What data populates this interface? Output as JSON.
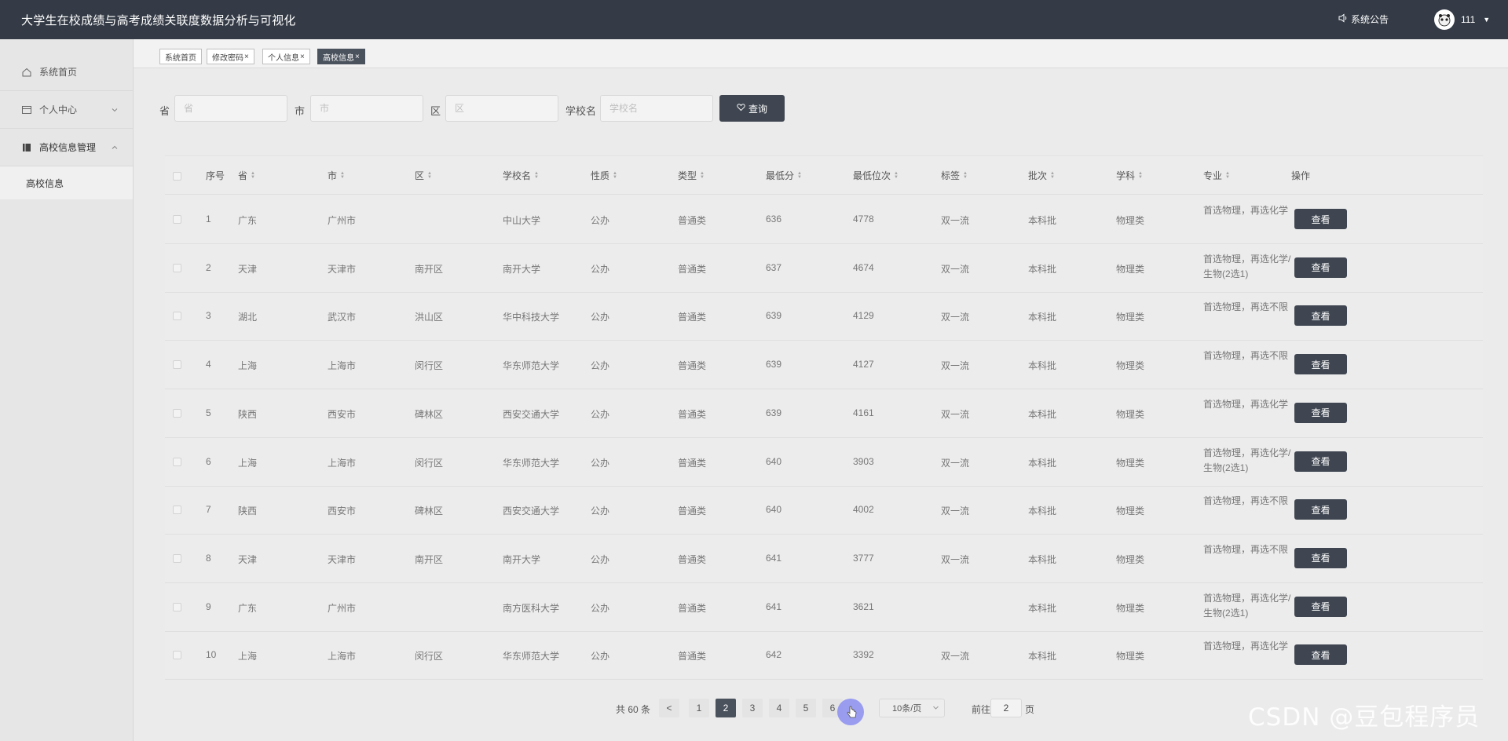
{
  "app": {
    "title": "大学生在校成绩与高考成绩关联度数据分析与可视化"
  },
  "header": {
    "notice_label": "系统公告",
    "username": "111"
  },
  "sidebar": {
    "items": [
      {
        "label": "系统首页"
      },
      {
        "label": "个人中心"
      },
      {
        "label": "高校信息管理"
      }
    ],
    "subitem": {
      "label": "高校信息"
    }
  },
  "tabs": [
    {
      "label": "系统首页"
    },
    {
      "label": "修改密码"
    },
    {
      "label": "个人信息"
    },
    {
      "label": "高校信息"
    }
  ],
  "search": {
    "province_label": "省",
    "province_placeholder": "省",
    "city_label": "市",
    "city_placeholder": "市",
    "district_label": "区",
    "district_placeholder": "区",
    "school_label": "学校名",
    "school_placeholder": "学校名",
    "button_label": "查询"
  },
  "table": {
    "columns": [
      "序号",
      "省",
      "市",
      "区",
      "学校名",
      "性质",
      "类型",
      "最低分",
      "最低位次",
      "标签",
      "批次",
      "学科",
      "专业",
      "操作"
    ],
    "view_label": "查看",
    "rows": [
      [
        "1",
        "广东",
        "广州市",
        "",
        "中山大学",
        "公办",
        "普通类",
        "636",
        "4778",
        "双一流",
        "本科批",
        "物理类",
        "首选物理，再选化学"
      ],
      [
        "2",
        "天津",
        "天津市",
        "南开区",
        "南开大学",
        "公办",
        "普通类",
        "637",
        "4674",
        "双一流",
        "本科批",
        "物理类",
        "首选物理，再选化学/生物(2选1)"
      ],
      [
        "3",
        "湖北",
        "武汉市",
        "洪山区",
        "华中科技大学",
        "公办",
        "普通类",
        "639",
        "4129",
        "双一流",
        "本科批",
        "物理类",
        "首选物理，再选不限"
      ],
      [
        "4",
        "上海",
        "上海市",
        "闵行区",
        "华东师范大学",
        "公办",
        "普通类",
        "639",
        "4127",
        "双一流",
        "本科批",
        "物理类",
        "首选物理，再选不限"
      ],
      [
        "5",
        "陕西",
        "西安市",
        "碑林区",
        "西安交通大学",
        "公办",
        "普通类",
        "639",
        "4161",
        "双一流",
        "本科批",
        "物理类",
        "首选物理，再选化学"
      ],
      [
        "6",
        "上海",
        "上海市",
        "闵行区",
        "华东师范大学",
        "公办",
        "普通类",
        "640",
        "3903",
        "双一流",
        "本科批",
        "物理类",
        "首选物理，再选化学/生物(2选1)"
      ],
      [
        "7",
        "陕西",
        "西安市",
        "碑林区",
        "西安交通大学",
        "公办",
        "普通类",
        "640",
        "4002",
        "双一流",
        "本科批",
        "物理类",
        "首选物理，再选不限"
      ],
      [
        "8",
        "天津",
        "天津市",
        "南开区",
        "南开大学",
        "公办",
        "普通类",
        "641",
        "3777",
        "双一流",
        "本科批",
        "物理类",
        "首选物理，再选不限"
      ],
      [
        "9",
        "广东",
        "广州市",
        "",
        "南方医科大学",
        "公办",
        "普通类",
        "641",
        "3621",
        "",
        "本科批",
        "物理类",
        "首选物理，再选化学/生物(2选1)"
      ],
      [
        "10",
        "上海",
        "上海市",
        "闵行区",
        "华东师范大学",
        "公办",
        "普通类",
        "642",
        "3392",
        "双一流",
        "本科批",
        "物理类",
        "首选物理，再选化学"
      ]
    ]
  },
  "pagination": {
    "total_text": "共 60 条",
    "prev": "<",
    "pages": [
      "1",
      "2",
      "3",
      "4",
      "5",
      "6"
    ],
    "current_page": "2",
    "page_size": "10条/页",
    "goto_prefix": "前往",
    "goto_value": "2",
    "goto_suffix": "页"
  },
  "watermark": "CSDN @豆包程序员",
  "colors": {
    "topbar": "#343b46",
    "button": "#3f4651",
    "active_tab": "#4a525d",
    "cursor": "#8b8ff0"
  }
}
